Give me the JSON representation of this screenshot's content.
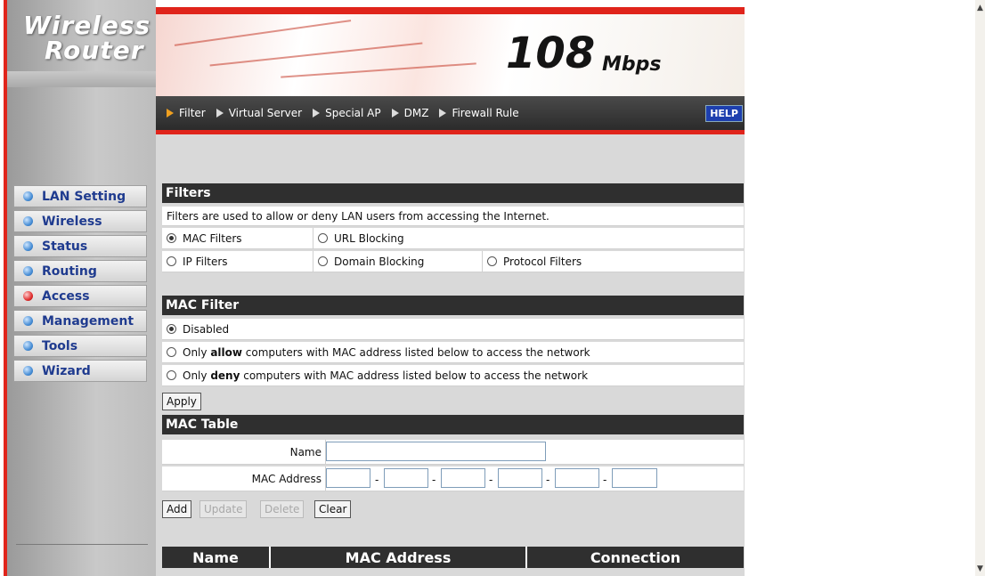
{
  "logo": {
    "line1": "Wireless",
    "line2": "Router"
  },
  "banner": {
    "speed": "108",
    "unit": "Mbps",
    "help": "HELP"
  },
  "tabs": [
    {
      "label": "Filter",
      "active": true
    },
    {
      "label": "Virtual Server"
    },
    {
      "label": "Special AP"
    },
    {
      "label": "DMZ"
    },
    {
      "label": "Firewall Rule"
    }
  ],
  "sidebar": {
    "items": [
      {
        "label": "LAN Setting"
      },
      {
        "label": "Wireless"
      },
      {
        "label": "Status"
      },
      {
        "label": "Routing"
      },
      {
        "label": "Access",
        "active": true
      },
      {
        "label": "Management"
      },
      {
        "label": "Tools"
      },
      {
        "label": "Wizard"
      }
    ]
  },
  "filters": {
    "title": "Filters",
    "description": "Filters are used to allow or deny LAN users from accessing the Internet.",
    "options": {
      "mac": "MAC Filters",
      "url": "URL Blocking",
      "ip": "IP Filters",
      "domain": "Domain Blocking",
      "protocol": "Protocol Filters"
    },
    "selected": "MAC Filters"
  },
  "mac_filter": {
    "title": "MAC Filter",
    "disabled": "Disabled",
    "allow_prefix": "Only ",
    "allow_word": "allow",
    "allow_suffix": " computers with MAC address listed below to access the network",
    "deny_prefix": "Only ",
    "deny_word": "deny",
    "deny_suffix": " computers with MAC address listed below to access the network",
    "selected": "Disabled",
    "apply": "Apply"
  },
  "mac_table": {
    "title": "MAC Table",
    "name_label": "Name",
    "mac_label": "MAC Address",
    "name_value": "",
    "mac_separator": "-",
    "buttons": {
      "add": "Add",
      "update": "Update",
      "delete": "Delete",
      "clear": "Clear"
    },
    "columns": [
      "Name",
      "MAC Address",
      "Connection"
    ]
  },
  "colors": {
    "accent_red": "#e0241b",
    "header_dark": "#2f2f2f",
    "menu_text": "#1f3b8f"
  }
}
